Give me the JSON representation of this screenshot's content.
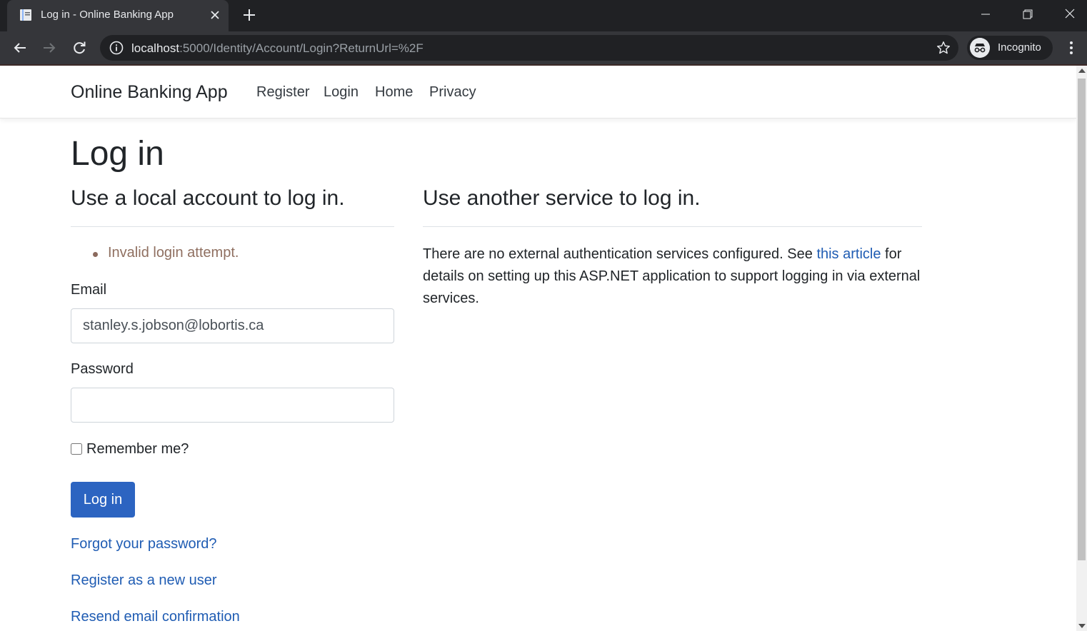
{
  "browser": {
    "tab_title": "Log in - Online Banking App",
    "url_host": "localhost",
    "url_rest": ":5000/Identity/Account/Login?ReturnUrl=%2F",
    "profile_label": "Incognito"
  },
  "navbar": {
    "brand": "Online Banking App",
    "links": [
      "Register",
      "Login",
      "Home",
      "Privacy"
    ]
  },
  "page": {
    "title": "Log in",
    "local_heading": "Use a local account to log in.",
    "external_heading": "Use another service to log in.",
    "error_message": "Invalid login attempt.",
    "email_label": "Email",
    "email_value": "stanley.s.jobson@lobortis.ca",
    "password_label": "Password",
    "password_value": "",
    "remember_label": "Remember me?",
    "remember_checked": false,
    "login_button": "Log in",
    "forgot_link": "Forgot your password?",
    "register_link": "Register as a new user",
    "resend_link": "Resend email confirmation",
    "external_text_before": "There are no external authentication services configured. See ",
    "external_link": "this article",
    "external_text_after": " for details on setting up this ASP.NET application to support logging in via external services."
  },
  "colors": {
    "primary": "#2c64c1",
    "link": "#1f5cb3",
    "error": "#8f6f60",
    "chrome_dark": "#202124"
  }
}
